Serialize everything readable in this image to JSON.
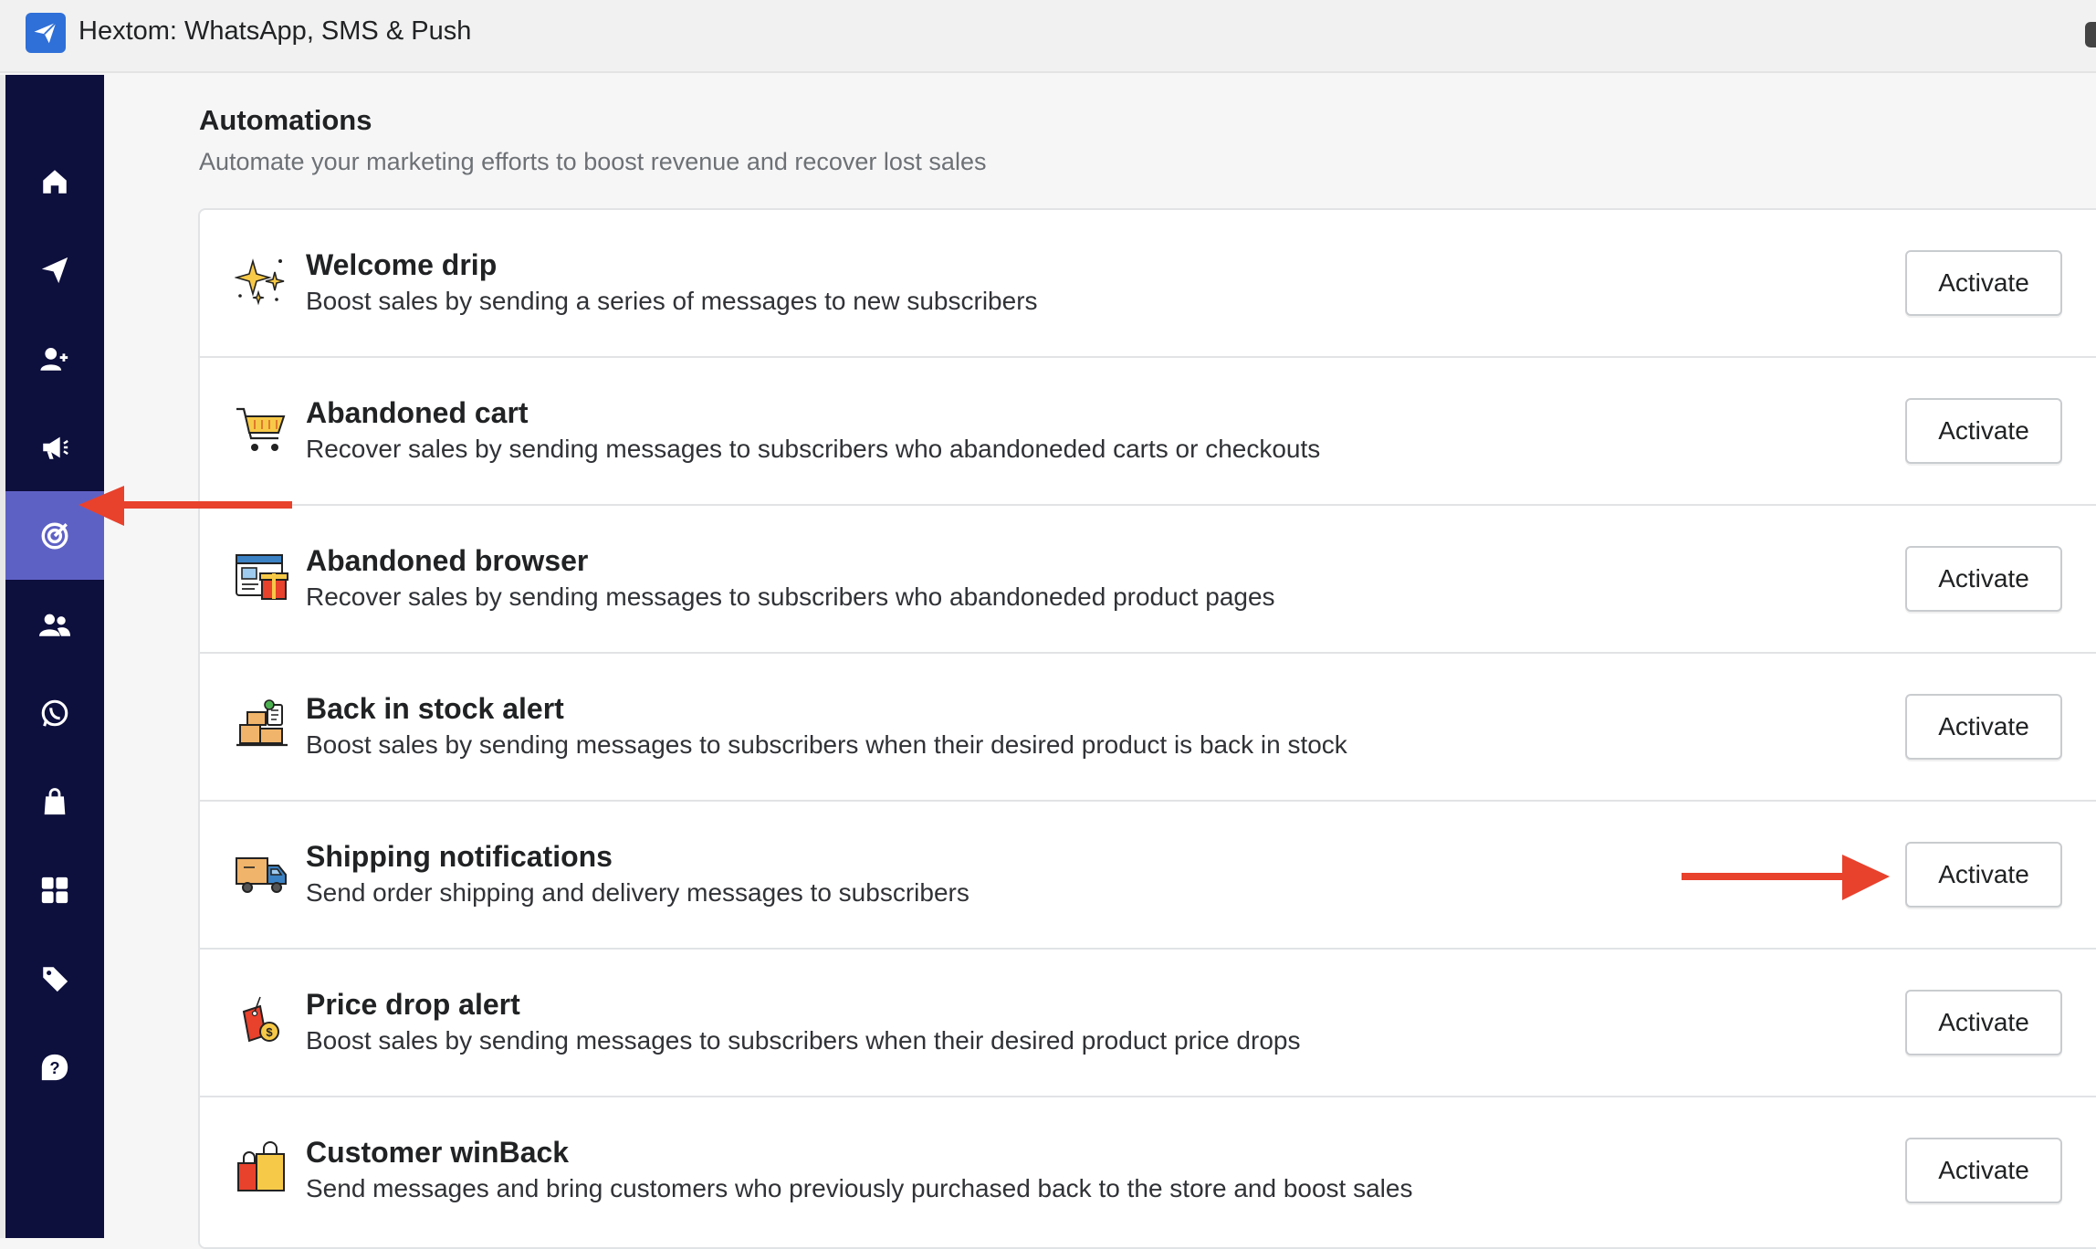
{
  "app": {
    "title": "Hextom: WhatsApp, SMS & Push",
    "logo_icon": "paper-plane-logo-icon"
  },
  "sidebar": {
    "background": "#0d0f3d",
    "active_color": "#5e61c4",
    "items": [
      {
        "icon": "home-icon",
        "active": false
      },
      {
        "icon": "paper-plane-icon",
        "active": false
      },
      {
        "icon": "add-user-icon",
        "active": false
      },
      {
        "icon": "megaphone-icon",
        "active": false
      },
      {
        "icon": "target-icon",
        "active": true
      },
      {
        "icon": "users-icon",
        "active": false
      },
      {
        "icon": "whatsapp-icon",
        "active": false
      },
      {
        "icon": "shopping-bag-icon",
        "active": false
      },
      {
        "icon": "grid-icon",
        "active": false
      },
      {
        "icon": "tag-icon",
        "active": false
      },
      {
        "icon": "help-icon",
        "active": false
      }
    ]
  },
  "header": {
    "title": "Automations",
    "subtitle": "Automate your marketing efforts to boost revenue and recover lost sales"
  },
  "automations": [
    {
      "icon": "sparkles-icon",
      "title": "Welcome drip",
      "description": "Boost sales by sending a series of messages to new subscribers",
      "button": "Activate"
    },
    {
      "icon": "shopping-cart-icon",
      "title": "Abandoned cart",
      "description": "Recover sales by sending messages to subscribers who abandoneded carts or checkouts",
      "button": "Activate"
    },
    {
      "icon": "browser-gift-icon",
      "title": "Abandoned browser",
      "description": "Recover sales by sending messages to subscribers who abandoneded product pages",
      "button": "Activate"
    },
    {
      "icon": "stock-boxes-icon",
      "title": "Back in stock alert",
      "description": "Boost sales by sending messages to subscribers when their desired product is back in stock",
      "button": "Activate"
    },
    {
      "icon": "delivery-truck-icon",
      "title": "Shipping notifications",
      "description": "Send order shipping and delivery messages to subscribers",
      "button": "Activate"
    },
    {
      "icon": "price-tag-icon",
      "title": "Price drop alert",
      "description": "Boost sales by sending messages to subscribers when their desired product price drops",
      "button": "Activate"
    },
    {
      "icon": "shopping-bags-icon",
      "title": "Customer winBack",
      "description": "Send messages and bring customers who previously purchased back to the store and boost sales",
      "button": "Activate"
    }
  ],
  "annotations": {
    "arrow_color": "#e8412c"
  }
}
